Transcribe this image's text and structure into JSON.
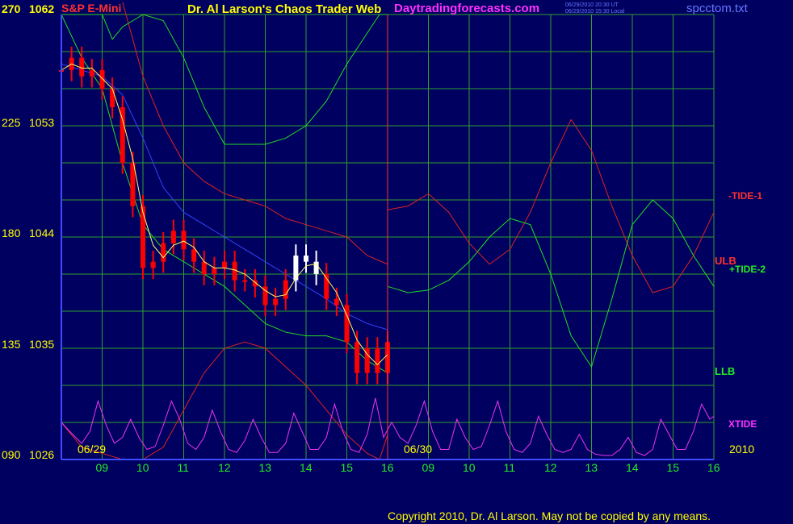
{
  "header": {
    "instrument": "S&P E-Mini",
    "title": "Dr. Al Larson's Chaos Trader Web",
    "site": "Daytradingforecasts.com",
    "stamp_utc": "06/29/2010 20:30 UT",
    "stamp_local": "06/29/2010 15:30 Local",
    "file": "spcctom.txt"
  },
  "copyright": "Copyright 2010, Dr. Al Larson. May not be copied by any means.",
  "colors": {
    "background": "#000060",
    "grid": "#2fa02f",
    "axis": "#3f4bff",
    "price_bar": "#ff0000",
    "price_bar_now": "#ffffff",
    "sma": "#ffff66",
    "red_line": "#dd2222",
    "green_line": "#22dd22",
    "blue_line": "#3344ff",
    "xtide": "#ee33ee",
    "title_red": "#ff3030",
    "title_yellow": "#ffff00",
    "title_magenta": "#ff30ff",
    "title_blue": "#6677ff",
    "date_yellow": "#ffff00",
    "hour_green": "#22ee22"
  },
  "chart_data": {
    "type": "line",
    "y_axis_left": {
      "outer_ticks": [
        "270",
        "225",
        "180",
        "135",
        "090"
      ],
      "inner_ticks": [
        "1062",
        "1053",
        "1044",
        "1035",
        "1026"
      ],
      "ylim": [
        1026,
        1062
      ]
    },
    "x_axis": {
      "hour_labels": [
        "09",
        "10",
        "11",
        "12",
        "13",
        "14",
        "15",
        "16",
        "09",
        "10",
        "11",
        "12",
        "13",
        "14",
        "15",
        "16"
      ],
      "date_labels": [
        "06/29",
        "06/30"
      ],
      "year_label": "2010",
      "divider_hour": 16
    },
    "series_labels": {
      "tide1": "-TIDE-1",
      "ulb": "ULB",
      "tide2": "+TIDE-2",
      "llb": "LLB",
      "xtide": "XTIDE"
    },
    "price_bars": {
      "note": "approximate close estimates, 06/29 session",
      "x": [
        8.0,
        8.25,
        8.5,
        8.75,
        9.0,
        9.25,
        9.5,
        9.75,
        10.0,
        10.25,
        10.5,
        10.75,
        11.0,
        11.25,
        11.5,
        11.75,
        12.0,
        12.25,
        12.5,
        12.75,
        13.0,
        13.25,
        13.5,
        13.75,
        14.0,
        14.25,
        14.5,
        14.75,
        15.0,
        15.25,
        15.5,
        15.75,
        16.0
      ],
      "close": [
        1057.5,
        1058.5,
        1057.0,
        1057.5,
        1056.0,
        1054.5,
        1050.0,
        1046.5,
        1041.5,
        1042.0,
        1043.5,
        1044.5,
        1043.0,
        1042.0,
        1041.0,
        1041.5,
        1042.0,
        1040.5,
        1040.5,
        1040.0,
        1038.5,
        1039.0,
        1040.5,
        1042.5,
        1042.0,
        1041.0,
        1039.0,
        1038.5,
        1035.5,
        1033.0,
        1035.0,
        1033.0,
        1035.5
      ]
    },
    "upper_red": {
      "x": [
        9.5,
        10.0,
        10.5,
        11.0,
        11.5,
        12.0,
        12.5,
        13.0,
        13.5,
        14.0,
        14.5,
        15.0,
        15.5,
        16.0
      ],
      "y": [
        1063,
        1057,
        1053,
        1050,
        1048.5,
        1047.5,
        1047.0,
        1046.5,
        1045.5,
        1045.0,
        1044.5,
        1044.0,
        1042.5,
        1041.8
      ]
    },
    "upper_green": {
      "x": [
        8.0,
        8.5,
        9.0,
        9.25,
        9.5,
        10.0,
        10.5,
        11.0,
        11.5,
        12.0,
        12.5,
        13.0,
        13.5,
        14.0,
        14.5,
        15.0,
        15.5,
        15.8,
        16.0
      ],
      "y": [
        1062,
        1062,
        1062,
        1060,
        1061,
        1062,
        1061.5,
        1058.5,
        1054.5,
        1051.5,
        1051.5,
        1051.5,
        1052.0,
        1053.0,
        1055.0,
        1058.0,
        1060.5,
        1062,
        1062
      ]
    },
    "blue_avg": {
      "x": [
        8.0,
        8.5,
        9.0,
        9.5,
        10.0,
        10.5,
        11.0,
        11.5,
        12.0,
        12.5,
        13.0,
        13.5,
        14.0,
        14.5,
        15.0,
        15.5,
        16.0
      ],
      "y": [
        1058,
        1057.5,
        1057,
        1055.5,
        1052,
        1048,
        1046,
        1045,
        1044,
        1043,
        1042,
        1041,
        1040,
        1039,
        1037.8,
        1037.0,
        1036.5
      ]
    },
    "lower_green": {
      "x": [
        8.0,
        8.5,
        9.0,
        9.5,
        10.0,
        10.5,
        11.0,
        11.5,
        12.0,
        12.5,
        13.0,
        13.5,
        14.0,
        14.5,
        15.0,
        15.5,
        16.0
      ],
      "y": [
        1062,
        1058.5,
        1056,
        1050,
        1045,
        1043,
        1042,
        1041,
        1040,
        1038.5,
        1037,
        1036.3,
        1036.0,
        1036.0,
        1035.5,
        1034.0,
        1033.0
      ]
    },
    "lower_red": {
      "x": [
        8.0,
        8.5,
        9.0,
        9.5,
        10.0,
        10.5,
        11.0,
        11.5,
        12.0,
        12.5,
        13.0,
        13.5,
        14.0,
        14.5,
        15.0,
        15.5,
        15.8,
        16.0
      ],
      "y": [
        1029,
        1027,
        1026.5,
        1026,
        1026,
        1027,
        1030,
        1033,
        1035,
        1035.5,
        1035.0,
        1033.5,
        1032,
        1030,
        1028,
        1026.5,
        1026,
        1028
      ]
    },
    "forecast_tide1": {
      "x": [
        16.0,
        16.5,
        17.0,
        17.5,
        18.0,
        18.5,
        19.0,
        19.5,
        20.0,
        20.5,
        21.0,
        21.5,
        22.0,
        22.5,
        23.0,
        23.5,
        24.0
      ],
      "y": [
        1046.2,
        1046.5,
        1047.5,
        1046.0,
        1043.5,
        1041.8,
        1043.0,
        1046.0,
        1050.0,
        1053.5,
        1051.0,
        1046.5,
        1042.5,
        1039.5,
        1040.0,
        1042.5,
        1046.0
      ]
    },
    "forecast_tide2": {
      "x": [
        16.0,
        16.5,
        17.0,
        17.5,
        18.0,
        18.5,
        19.0,
        19.5,
        20.0,
        20.5,
        21.0,
        21.5,
        22.0,
        22.5,
        23.0,
        23.5,
        24.0
      ],
      "y": [
        1040.0,
        1039.5,
        1039.7,
        1040.5,
        1042.0,
        1044.0,
        1045.5,
        1045.0,
        1041.0,
        1036.0,
        1033.5,
        1039.0,
        1045.0,
        1047.0,
        1045.5,
        1042.5,
        1040.0
      ],
      "current_segment": {
        "x": [
          16.0,
          16.5,
          17.0
        ],
        "y": [
          1040.0,
          1039.5,
          1040.0
        ]
      }
    },
    "xtide": {
      "note": "periodic oscillator plotted at bottom band (relative 0-1)",
      "x": [
        8.0,
        8.2,
        8.5,
        8.7,
        8.9,
        9.1,
        9.3,
        9.5,
        9.7,
        9.9,
        10.1,
        10.3,
        10.5,
        10.7,
        10.9,
        11.1,
        11.3,
        11.5,
        11.7,
        11.9,
        12.1,
        12.3,
        12.5,
        12.7,
        12.9,
        13.1,
        13.3,
        13.5,
        13.7,
        13.9,
        14.1,
        14.3,
        14.5,
        14.7,
        14.9,
        15.1,
        15.3,
        15.5,
        15.7,
        15.9,
        16.1,
        16.3,
        16.5,
        16.7,
        16.9,
        17.1,
        17.3,
        17.5,
        17.7,
        17.9,
        18.1,
        18.3,
        18.5,
        18.7,
        18.9,
        19.1,
        19.3,
        19.5,
        19.7,
        19.9,
        20.1,
        20.3,
        20.5,
        20.7,
        20.9,
        21.1,
        21.3,
        21.5,
        21.7,
        21.9,
        22.1,
        22.3,
        22.5,
        22.7,
        22.9,
        23.1,
        23.3,
        23.5,
        23.7,
        23.9,
        24.0
      ],
      "y": [
        0.55,
        0.4,
        0.2,
        0.4,
        0.9,
        0.5,
        0.2,
        0.3,
        0.6,
        0.3,
        0.1,
        0.15,
        0.5,
        0.9,
        0.6,
        0.2,
        0.1,
        0.3,
        0.75,
        0.4,
        0.1,
        0.05,
        0.25,
        0.6,
        0.3,
        0.05,
        0.05,
        0.2,
        0.7,
        0.4,
        0.1,
        0.1,
        0.3,
        0.85,
        0.4,
        0.1,
        0.05,
        0.35,
        0.95,
        0.3,
        0.55,
        0.3,
        0.2,
        0.5,
        0.9,
        0.4,
        0.1,
        0.1,
        0.6,
        0.3,
        0.1,
        0.15,
        0.5,
        0.9,
        0.4,
        0.1,
        0.05,
        0.2,
        0.65,
        0.35,
        0.1,
        0.05,
        0.1,
        0.35,
        0.1,
        0.02,
        0.0,
        0.0,
        0.1,
        0.3,
        0.05,
        0.0,
        0.1,
        0.6,
        0.35,
        0.1,
        0.1,
        0.4,
        0.85,
        0.6,
        0.65
      ]
    }
  }
}
